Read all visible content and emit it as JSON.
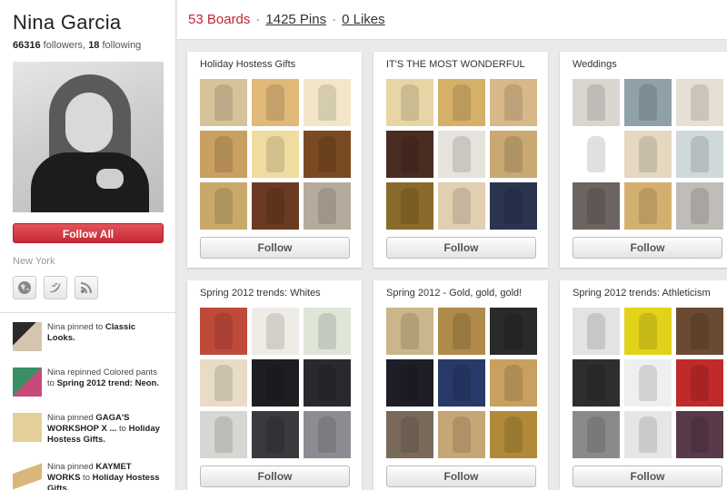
{
  "profile": {
    "name": "Nina Garcia",
    "followers_count": "66316",
    "followers_label": "followers,",
    "following_count": "18",
    "following_label": "following",
    "follow_all_label": "Follow All",
    "location": "New York"
  },
  "social_links": [
    "globe-icon",
    "twitter-icon",
    "rss-icon"
  ],
  "activity": [
    {
      "text_pre": "Nina pinned to ",
      "target": "Classic Looks.",
      "color": "#6b5a4e"
    },
    {
      "text_pre": "Nina repinned Colored pants to ",
      "target": "Spring 2012 trend: Neon.",
      "color": "#3a8f64"
    },
    {
      "text_pre": "Nina pinned ",
      "item": "GAGA'S WORKSHOP X ...",
      "text_mid": " to ",
      "target": "Holiday Hostess Gifts.",
      "color": "#e3cf9a"
    },
    {
      "text_pre": "Nina pinned ",
      "item": "KAYMET WORKS",
      "text_mid": " to ",
      "target": "Holiday Hostess Gifts.",
      "color": "#d9b77a"
    }
  ],
  "topbar": {
    "boards": "53 Boards",
    "sep1": "·",
    "pins": "1425 Pins",
    "sep2": "·",
    "likes": "0 Likes"
  },
  "boards": [
    {
      "title": "Holiday Hostess Gifts",
      "follow_label": "Follow",
      "thumbs": [
        "#d6c39a",
        "#e0b878",
        "#f3e7c8",
        "#c9a060",
        "#f0dca0",
        "#7a4a22",
        "#c9a96a",
        "#6a3b22",
        "#b5aa9c"
      ]
    },
    {
      "title": "IT'S THE MOST WONDERFUL",
      "follow_label": "Follow",
      "thumbs": [
        "#e8d5a5",
        "#d6b068",
        "#d8b889",
        "#4a2c22",
        "#e6e2dc",
        "#c9a872",
        "#8a6a2a",
        "#e2cfb2",
        "#2b3550"
      ]
    },
    {
      "title": "Weddings",
      "follow_label": "Follow",
      "thumbs": [
        "#d9d6d0",
        "#8fa0a8",
        "#e6e0d4",
        "#ffffff",
        "#e4d8c0",
        "#cfd8da",
        "#6b6460",
        "#d4b070",
        "#c0bcb8"
      ]
    },
    {
      "title": "Spring 2012 trends: Whites",
      "follow_label": "Follow",
      "thumbs": [
        "#c04a3a",
        "#efece6",
        "#dfe6d8",
        "#e8dcc6",
        "#1e1e22",
        "#2a2a2e",
        "#d6d6d2",
        "#3a3a3e",
        "#8c8c92"
      ]
    },
    {
      "title": "Spring 2012 - Gold, gold, gold!",
      "follow_label": "Follow",
      "thumbs": [
        "#cbb58a",
        "#b08a4a",
        "#2a2a2a",
        "#1e1e28",
        "#283a6a",
        "#c8a060",
        "#7a6a5a",
        "#c6a676",
        "#b08a38"
      ]
    },
    {
      "title": "Spring 2012 trends: Athleticism",
      "follow_label": "Follow",
      "thumbs": [
        "#e3e3e3",
        "#e2d21a",
        "#6a4a32",
        "#2e2e2e",
        "#efefef",
        "#c02a2a",
        "#8a8a8a",
        "#e6e6e6",
        "#5a3a4a"
      ]
    }
  ]
}
